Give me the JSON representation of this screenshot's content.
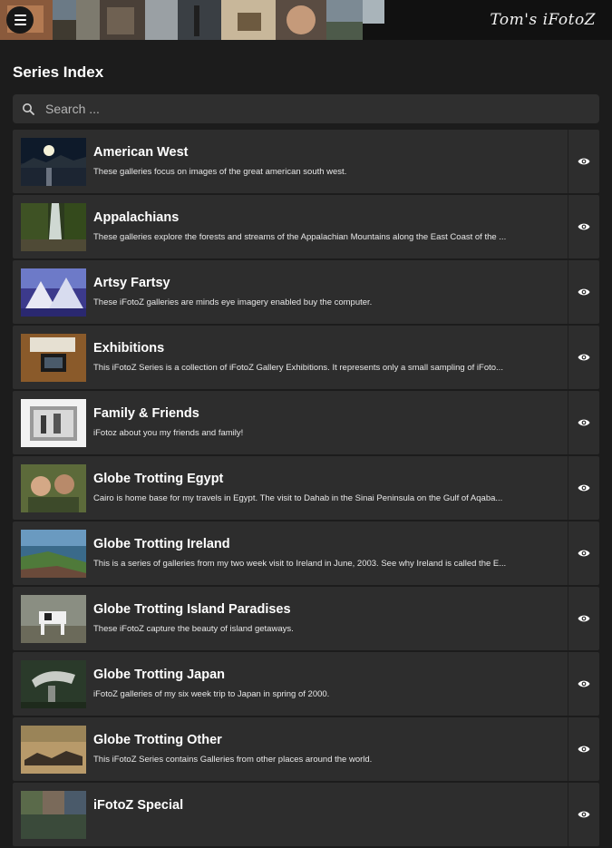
{
  "header": {
    "brand": "Tom's iFotoZ",
    "menu_icon": "menu-icon"
  },
  "page": {
    "title": "Series Index"
  },
  "search": {
    "placeholder": "Search ...",
    "value": "",
    "icon": "search-icon"
  },
  "series": [
    {
      "title": "American West",
      "description": "These galleries focus on images of the great american south west."
    },
    {
      "title": "Appalachians",
      "description": "These galleries explore the forests and streams of the Appalachian Mountains along the East Coast of the ..."
    },
    {
      "title": "Artsy Fartsy",
      "description": "These iFotoZ galleries are minds eye imagery enabled buy the computer."
    },
    {
      "title": "Exhibitions",
      "description": "This iFotoZ Series is a collection of iFotoZ Gallery Exhibitions. It represents only a small sampling of iFoto..."
    },
    {
      "title": "Family & Friends",
      "description": "iFotoz about you my friends and family!"
    },
    {
      "title": "Globe Trotting Egypt",
      "description": "Cairo is  home base for my travels in Egypt. The visit to Dahab in the Sinai Peninsula on the Gulf of Aqaba..."
    },
    {
      "title": "Globe Trotting Ireland",
      "description": "This is a series of galleries from my two week visit to Ireland in June, 2003. See why Ireland is called the E..."
    },
    {
      "title": "Globe Trotting Island Paradises",
      "description": "These iFotoZ capture the beauty of island getaways."
    },
    {
      "title": "Globe Trotting Japan",
      "description": "iFotoZ galleries of my six week trip to Japan in spring of 2000."
    },
    {
      "title": "Globe Trotting Other",
      "description": "This iFotoZ Series contains Galleries from other places around the world."
    },
    {
      "title": "iFotoZ Special",
      "description": ""
    }
  ],
  "view_icon": "eye-icon",
  "colors": {
    "background": "#1c1c1c",
    "row": "#2d2d2d",
    "search": "#2f2f2f"
  }
}
